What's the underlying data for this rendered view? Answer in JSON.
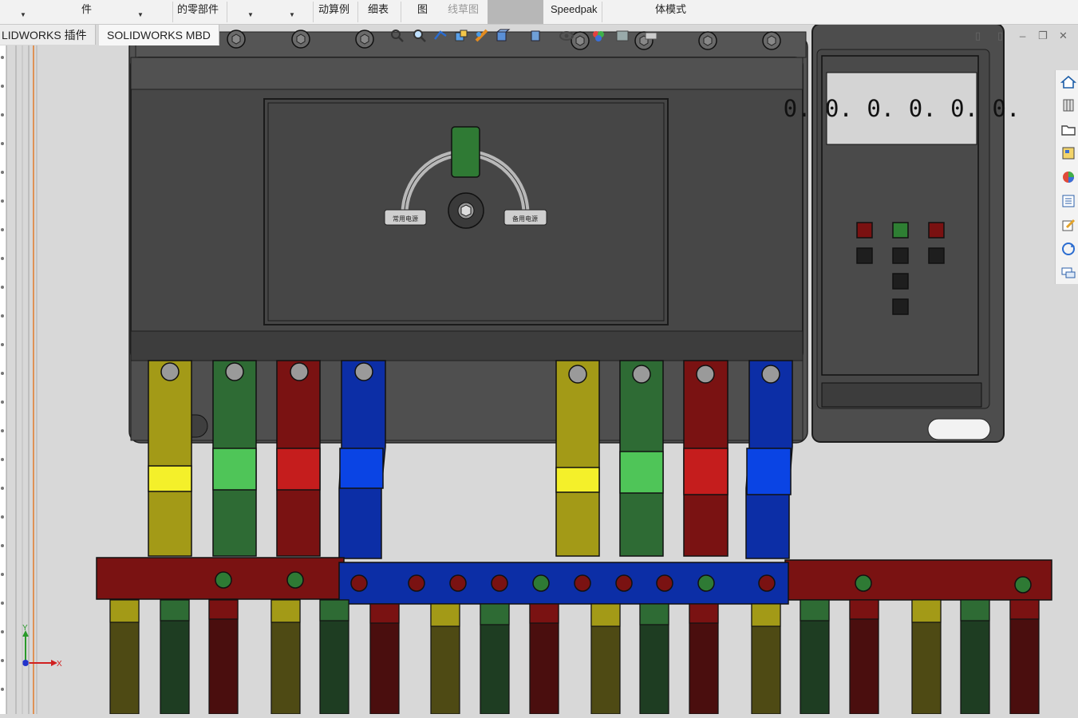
{
  "ribbon": {
    "items": [
      {
        "label": "件"
      },
      {
        "label": "的零部件"
      },
      {
        "label": "动算例"
      },
      {
        "label": "细表"
      },
      {
        "label": "图"
      },
      {
        "label": "线草图"
      },
      {
        "label": "Speedpak"
      },
      {
        "label": "体模式"
      }
    ]
  },
  "cmd_tabs": [
    {
      "label": "LIDWORKS 插件"
    },
    {
      "label": "SOLIDWORKS MBD"
    }
  ],
  "display": {
    "digits": "0. 0. 0. 0. 0. 0."
  },
  "axis": {
    "x": "X",
    "y": "Y"
  },
  "colors": {
    "phase_yellow": "#a39a17",
    "phase_green": "#2e6b34",
    "phase_red": "#7a1212",
    "phase_blue": "#0c2ea6",
    "housing": "#4a4a4a",
    "background": "#d8d8d8"
  },
  "hud_icons": [
    "zoom-to-fit-icon",
    "zoom-area-icon",
    "previous-view-icon",
    "section-view-icon",
    "dynamic-annotation-icon",
    "view-orientation-icon",
    "display-style-icon",
    "hide-show-icon",
    "edit-appearance-icon",
    "apply-scene-icon",
    "view-settings-icon"
  ],
  "taskpane_icons": [
    "home-icon",
    "design-library-icon",
    "file-explorer-icon",
    "view-palette-icon",
    "appearances-icon",
    "custom-properties-icon",
    "solidworks-forum-icon",
    "refresh-icon",
    "chat-icon"
  ]
}
